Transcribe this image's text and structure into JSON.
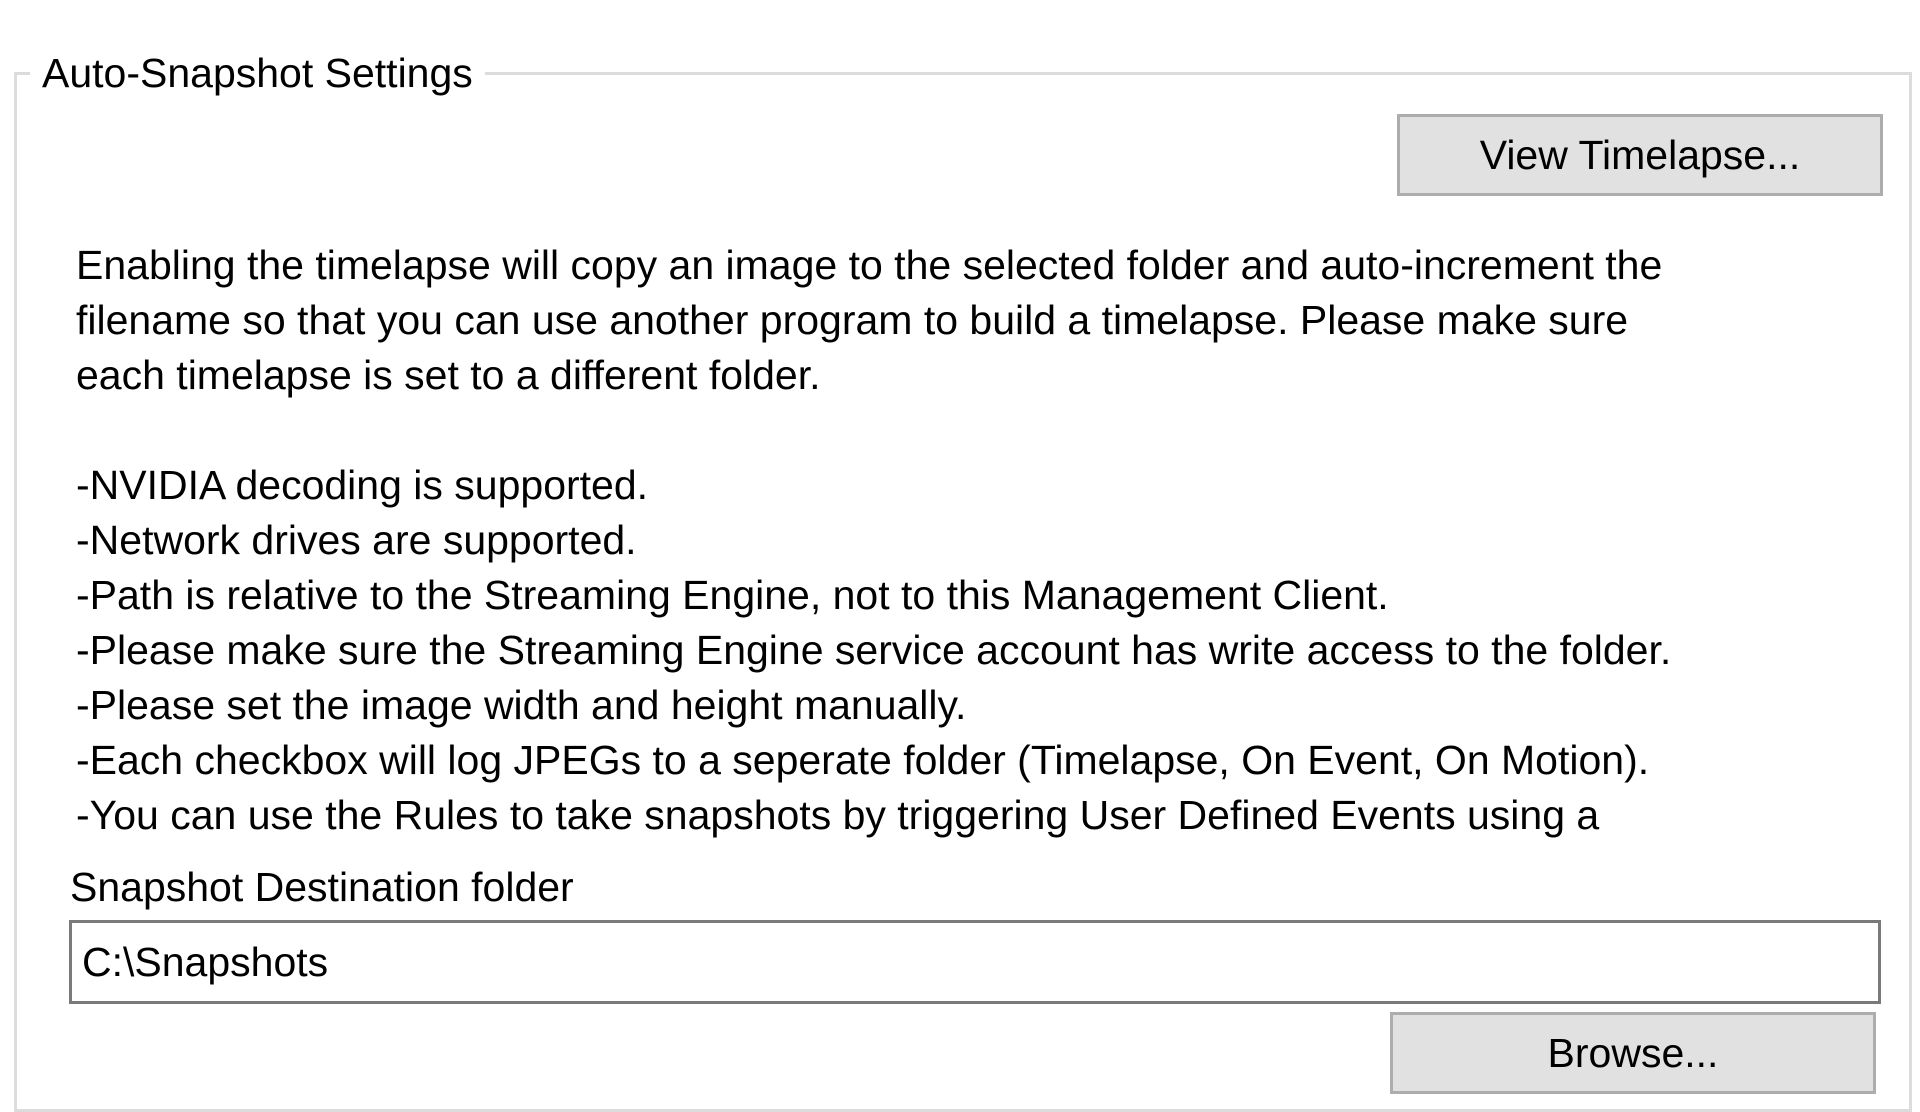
{
  "group": {
    "title": "Auto-Snapshot Settings"
  },
  "buttons": {
    "view_timelapse": "View Timelapse...",
    "browse": "Browse..."
  },
  "description": {
    "intro_lines": [
      "Enabling the timelapse will copy an image to the selected folder and auto-increment the",
      "filename so that you can use another program to build a timelapse. Please make sure",
      "each timelapse is set to a different folder."
    ],
    "notes": [
      "-NVIDIA decoding is supported.",
      "-Network drives are supported.",
      "-Path is relative to the Streaming Engine, not to this Management Client.",
      "-Please make sure the Streaming Engine service account has write access to the folder.",
      "-Please set the image width and height manually.",
      "-Each checkbox will log JPEGs to a seperate folder (Timelapse, On Event, On Motion).",
      "-You can use the Rules to take snapshots by triggering User Defined Events using a"
    ]
  },
  "destination": {
    "label": "Snapshot Destination folder",
    "value": "C:\\Snapshots"
  }
}
